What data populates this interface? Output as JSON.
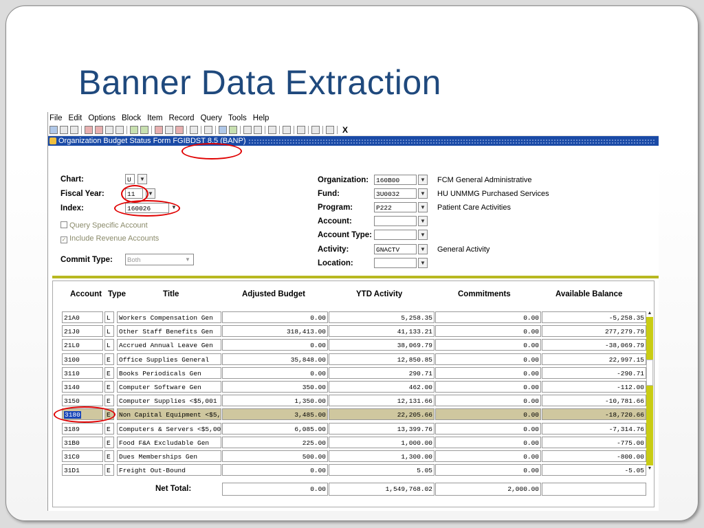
{
  "slide": {
    "title": "Banner Data Extraction"
  },
  "menu": [
    "File",
    "Edit",
    "Options",
    "Block",
    "Item",
    "Record",
    "Query",
    "Tools",
    "Help"
  ],
  "toolbar": {
    "close_label": "X"
  },
  "form": {
    "title_prefix": "Organization Budget Status Form",
    "title_code": "FGIBDST 8.5",
    "title_suffix": "(BANP)"
  },
  "key": {
    "chart_label": "Chart:",
    "chart_value": "U",
    "fy_label": "Fiscal Year:",
    "fy_value": "11",
    "index_label": "Index:",
    "index_value": "160026",
    "query_specific": "Query Specific Account",
    "include_revenue": "Include Revenue Accounts",
    "commit_label": "Commit Type:",
    "commit_value": "Both",
    "org_label": "Organization:",
    "org_value": "160B00",
    "org_desc": "FCM General Administrative",
    "fund_label": "Fund:",
    "fund_value": "3U0032",
    "fund_desc": "HU UNMMG Purchased Services",
    "program_label": "Program:",
    "program_value": "P222",
    "program_desc": "Patient Care Activities",
    "account_label": "Account:",
    "account_type_label": "Account Type:",
    "activity_label": "Activity:",
    "activity_value": "GNACTV",
    "activity_desc": "General Activity",
    "location_label": "Location:"
  },
  "table": {
    "headers": [
      "Account",
      "Type",
      "Title",
      "Adjusted Budget",
      "YTD Activity",
      "Commitments",
      "Available Balance"
    ],
    "rows": [
      [
        "21A0",
        "L",
        "Workers Compensation Gen",
        "0.00",
        "5,258.35",
        "0.00",
        "-5,258.35"
      ],
      [
        "21J0",
        "L",
        "Other Staff Benefits Gen",
        "318,413.00",
        "41,133.21",
        "0.00",
        "277,279.79"
      ],
      [
        "21L0",
        "L",
        "Accrued Annual Leave Gen",
        "0.00",
        "38,069.79",
        "0.00",
        "-38,069.79"
      ],
      [
        "3100",
        "E",
        "Office Supplies General",
        "35,848.00",
        "12,850.85",
        "0.00",
        "22,997.15"
      ],
      [
        "3110",
        "E",
        "Books Periodicals Gen",
        "0.00",
        "290.71",
        "0.00",
        "-290.71"
      ],
      [
        "3140",
        "E",
        "Computer Software Gen",
        "350.00",
        "462.00",
        "0.00",
        "-112.00"
      ],
      [
        "3150",
        "E",
        "Computer Supplies <$5,001",
        "1,350.00",
        "12,131.66",
        "0.00",
        "-10,781.66"
      ],
      [
        "3180",
        "E",
        "Non Capital Equipment <$5,00",
        "3,485.00",
        "22,205.66",
        "0.00",
        "-18,720.66"
      ],
      [
        "3189",
        "E",
        "Computers & Servers <$5,001",
        "6,085.00",
        "13,399.76",
        "0.00",
        "-7,314.76"
      ],
      [
        "31B0",
        "E",
        "Food F&A Excludable Gen",
        "225.00",
        "1,000.00",
        "0.00",
        "-775.00"
      ],
      [
        "31C0",
        "E",
        "Dues Memberships Gen",
        "500.00",
        "1,300.00",
        "0.00",
        "-800.00"
      ],
      [
        "31D1",
        "E",
        "Freight Out-Bound",
        "0.00",
        "5.05",
        "0.00",
        "-5.05"
      ]
    ],
    "net_total_label": "Net Total:",
    "net_total": [
      "0.00",
      "1,549,768.02",
      "2,000.00",
      ""
    ]
  },
  "colors": {
    "slide_title": "#1f497d",
    "form_bar": "#1a4aa6",
    "accent_bar": "#b8b820",
    "selected_row": "#cfc79f",
    "highlight_ring": "#e00000"
  }
}
